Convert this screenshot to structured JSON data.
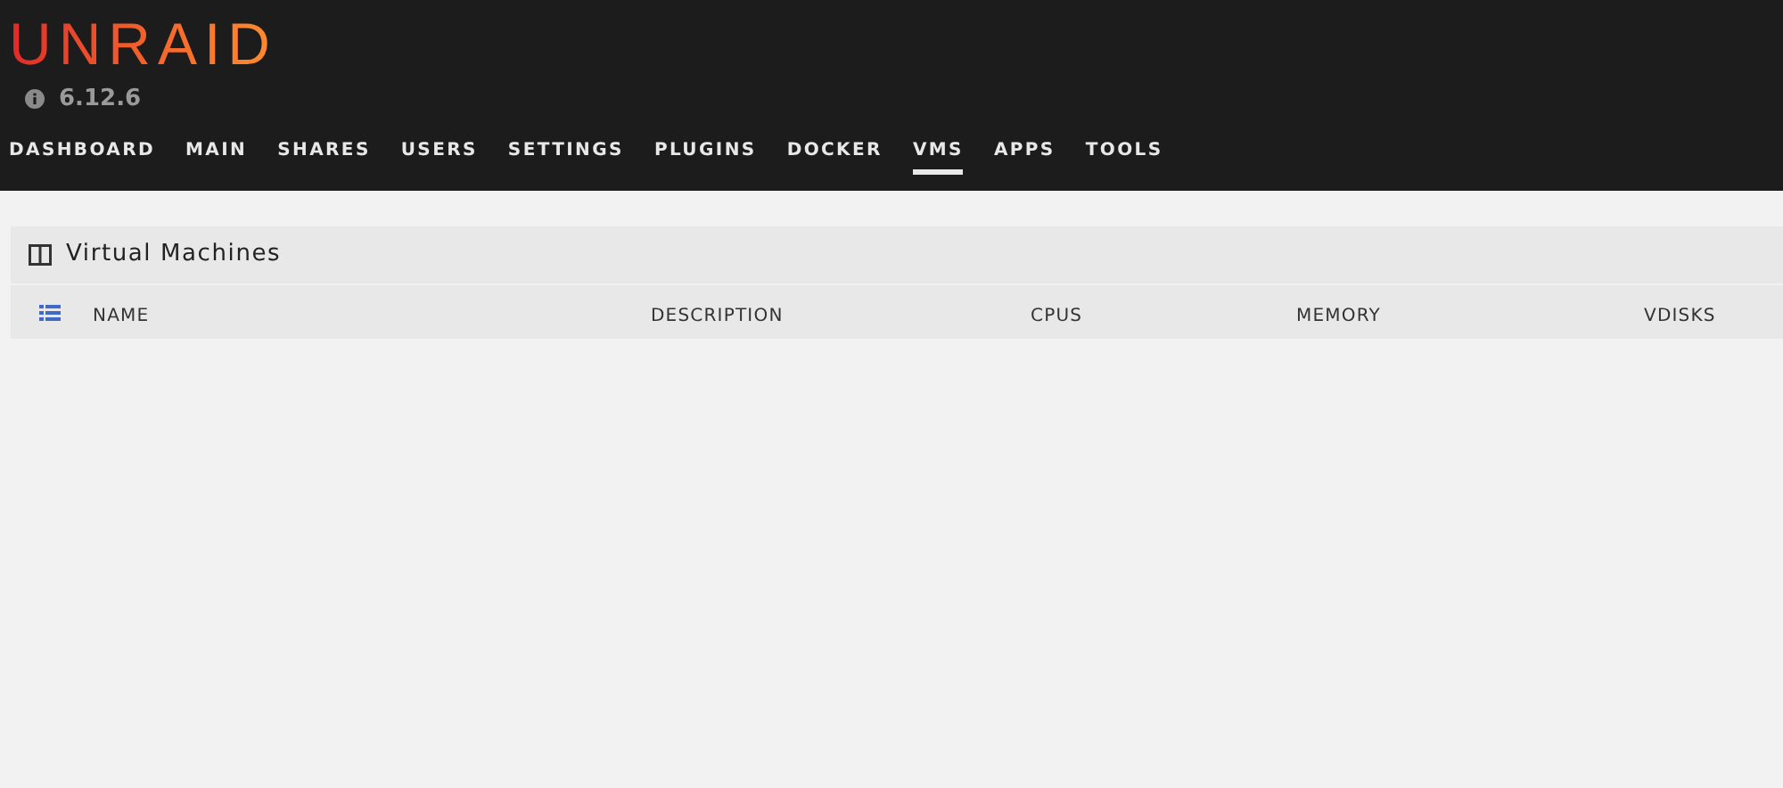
{
  "logo": "UNRAID",
  "version": "6.12.6",
  "nav": [
    {
      "label": "DASHBOARD",
      "selected": false
    },
    {
      "label": "MAIN",
      "selected": false
    },
    {
      "label": "SHARES",
      "selected": false
    },
    {
      "label": "USERS",
      "selected": false
    },
    {
      "label": "SETTINGS",
      "selected": false
    },
    {
      "label": "PLUGINS",
      "selected": false
    },
    {
      "label": "DOCKER",
      "selected": false
    },
    {
      "label": "VMS",
      "selected": true
    },
    {
      "label": "APPS",
      "selected": false
    },
    {
      "label": "TOOLS",
      "selected": false
    }
  ],
  "panel": {
    "title": "Virtual Machines",
    "table": {
      "columns": [
        "NAME",
        "DESCRIPTION",
        "CPUS",
        "MEMORY",
        "VDISKS"
      ]
    }
  }
}
